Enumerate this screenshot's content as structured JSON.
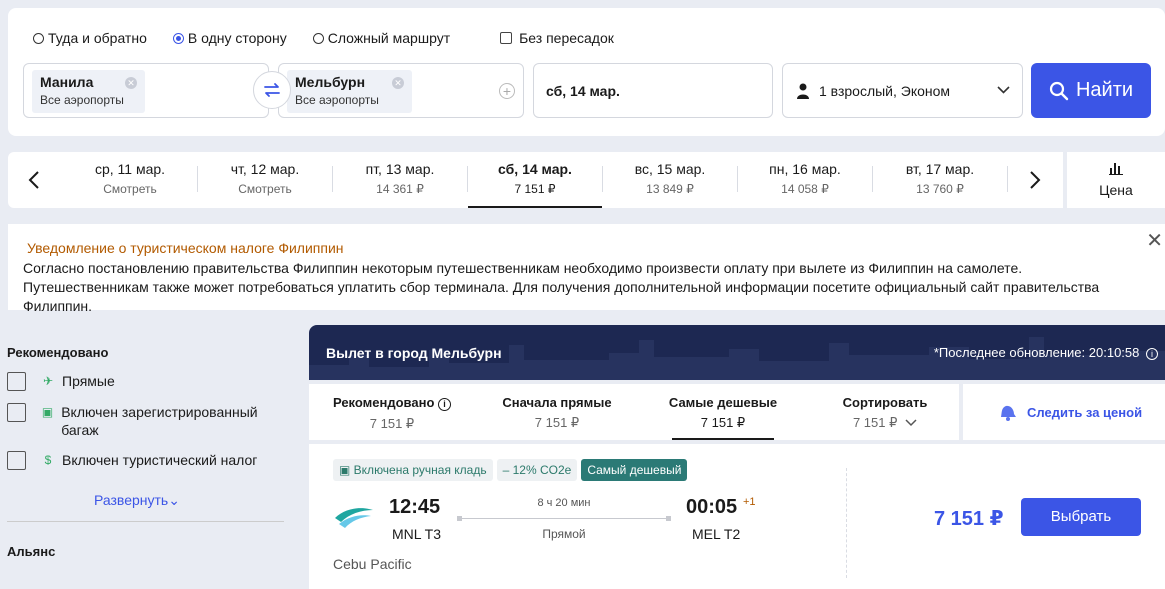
{
  "search": {
    "trip_options": [
      "Туда и обратно",
      "В одну сторону",
      "Сложный маршрут"
    ],
    "selected_trip": "В одну сторону",
    "nonstop_label": "Без пересадок",
    "from": {
      "city": "Манила",
      "airports": "Все аэропорты"
    },
    "to": {
      "city": "Мельбурн",
      "airports": "Все аэропорты"
    },
    "date": "сб, 14 мар.",
    "passengers": "1 взрослый, Эконом",
    "find_label": "Найти"
  },
  "date_strip": {
    "days": [
      {
        "date": "ср, 11 мар.",
        "price": "Смотреть"
      },
      {
        "date": "чт, 12 мар.",
        "price": "Смотреть"
      },
      {
        "date": "пт, 13 мар.",
        "price": "14 361 ₽"
      },
      {
        "date": "сб, 14 мар.",
        "price": "7 151 ₽"
      },
      {
        "date": "вс, 15 мар.",
        "price": "13 849 ₽"
      },
      {
        "date": "пн, 16 мар.",
        "price": "14 058 ₽"
      },
      {
        "date": "вт, 17 мар.",
        "price": "13 760 ₽"
      }
    ],
    "price_label": "Цена"
  },
  "notice": {
    "title": "Уведомление о туристическом налоге Филиппин",
    "body": "Согласно постановлению правительства Филиппин некоторым путешественникам необходимо произвести оплату при вылете из Филиппин на самолете. Путешественникам также может потребоваться уплатить сбор терминала. Для получения дополнительной информации посетите официальный сайт правительства Филиппин."
  },
  "filters": {
    "title": "Рекомендовано",
    "items": [
      "Прямые",
      "Включен зарегистрированный багаж",
      "Включен туристический налог"
    ],
    "expand_label": "Развернуть",
    "next_title": "Альянс"
  },
  "results": {
    "header_title": "Вылет в город Мельбурн",
    "updated": "*Последнее обновление: 20:10:58",
    "sorts": [
      {
        "name": "Рекомендовано",
        "value": "7 151 ₽"
      },
      {
        "name": "Сначала прямые",
        "value": "7 151 ₽"
      },
      {
        "name": "Самые дешевые",
        "value": "7 151 ₽"
      },
      {
        "name": "Сортировать",
        "value": "7 151 ₽"
      }
    ],
    "watch_label": "Следить за ценой"
  },
  "flight": {
    "tags": [
      "Включена ручная кладь",
      "– 12% CO2e",
      "Самый дешевый"
    ],
    "dep_time": "12:45",
    "dep_code": "MNL T3",
    "duration": "8 ч 20 мин",
    "stops": "Прямой",
    "arr_time": "00:05",
    "arr_plus": "+1",
    "arr_code": "MEL T2",
    "airline": "Cebu Pacific",
    "price": "7 151 ₽",
    "select_label": "Выбрать"
  },
  "colors": {
    "accent": "#3b55e6",
    "header": "#1d2852",
    "tag_dark": "#2b7a76",
    "notice_title": "#b25a00"
  }
}
